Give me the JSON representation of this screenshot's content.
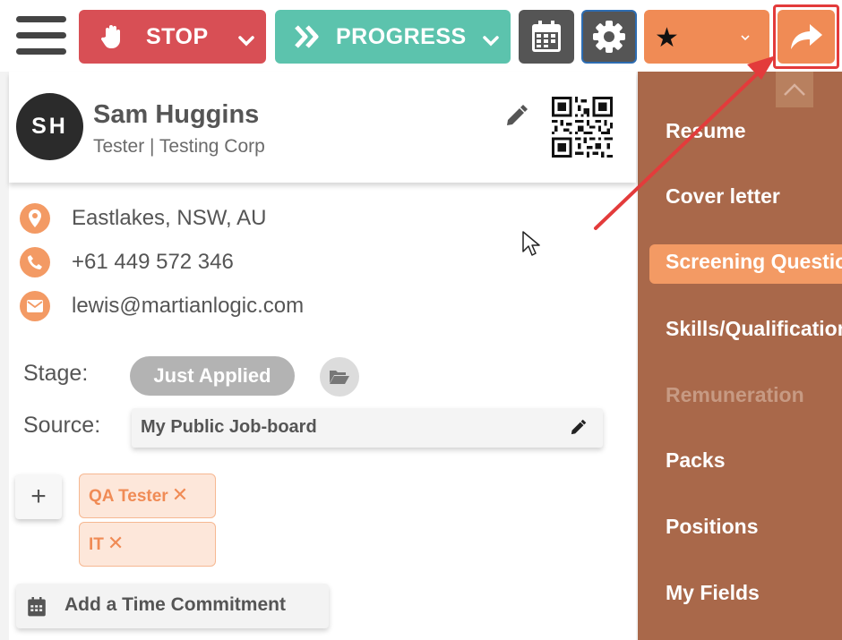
{
  "toolbar": {
    "menu_icon": "hamburger-icon",
    "stop_label": "STOP",
    "progress_label": "PROGRESS",
    "calendar_icon": "calendar-icon",
    "gear_icon": "gear-icon",
    "star_glyph": "★",
    "share_icon": "share-forward-icon"
  },
  "profile": {
    "initials": "SH",
    "name": "Sam Huggins",
    "subtitle": "Tester | Testing Corp"
  },
  "contact": {
    "location": "Eastlakes, NSW, AU",
    "phone": "+61 449 572 346",
    "email": "lewis@martianlogic.com"
  },
  "stage": {
    "label": "Stage:",
    "value": "Just Applied"
  },
  "source": {
    "label": "Source:",
    "value": "My Public Job-board"
  },
  "tags": {
    "add_label": "+",
    "items": [
      {
        "label": "QA Tester"
      },
      {
        "label": "IT"
      }
    ],
    "remove_glyph": "✕"
  },
  "time_commitment": {
    "label": "Add a Time Commitment"
  },
  "side_menu": {
    "items": [
      {
        "label": "Resume"
      },
      {
        "label": "Cover letter"
      },
      {
        "label": "Screening Questions"
      },
      {
        "label": "Skills/Qualifications"
      },
      {
        "label": "Remuneration"
      },
      {
        "label": "Packs"
      },
      {
        "label": "Positions"
      },
      {
        "label": "My Fields"
      }
    ]
  },
  "colors": {
    "stop": "#d84f55",
    "progress": "#5cc3ad",
    "accent_orange": "#f08b55",
    "side_menu_bg": "#a9684a",
    "annotation_red": "#e33b3b"
  }
}
